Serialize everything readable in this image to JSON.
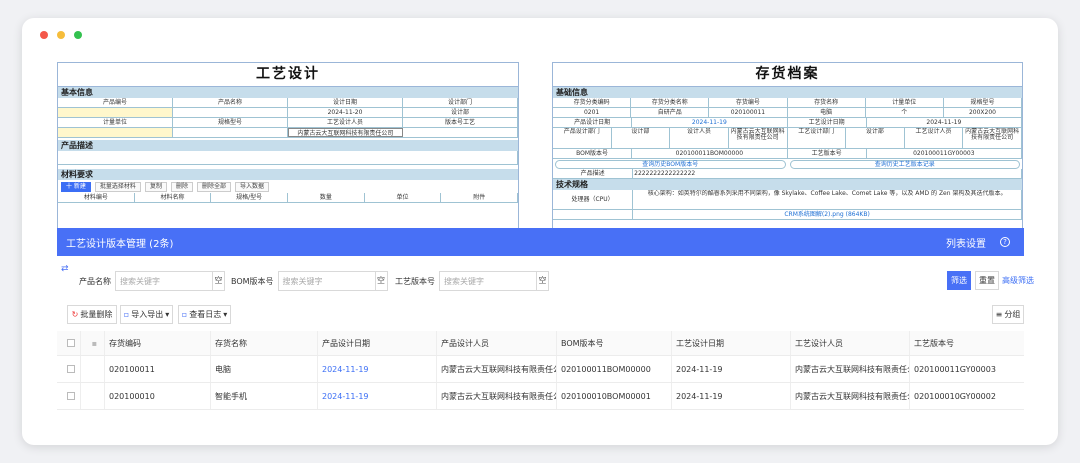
{
  "design_form": {
    "title": "工艺设计",
    "sections": {
      "basic": "基本信息",
      "desc": "产品描述",
      "materials": "材料要求"
    },
    "basic_headers": [
      "产品编号",
      "产品名称",
      "设计日期",
      "设计部门"
    ],
    "basic_row1": [
      "",
      "",
      "2024-11-20",
      "设计部"
    ],
    "basic_headers2": [
      "计量单位",
      "规格型号",
      "工艺设计人员",
      "版本号工艺"
    ],
    "basic_row2_person": "内蒙古云大互联网科技有限责任公司",
    "toolbar": [
      "十 新建",
      "批量选择材料",
      "复制",
      "删除",
      "删除全部",
      "导入数据"
    ],
    "material_headers": [
      "材料编号",
      "材料名称",
      "规格/型号",
      "数量",
      "单位",
      "附件"
    ]
  },
  "inventory_form": {
    "title": "存货档案",
    "sections": {
      "basic": "基础信息",
      "tech": "技术规格"
    },
    "headers": [
      "存货分类编码",
      "存货分类名称",
      "存货编号",
      "存货名称",
      "计量单位",
      "规格型号"
    ],
    "row1": [
      "0201",
      "自研产品",
      "020100011",
      "电脑",
      "个",
      "200X200"
    ],
    "row2": {
      "label1": "产品设计日期",
      "val1": "2024-11-19",
      "label2": "工艺设计日期",
      "val2": "2024-11-19"
    },
    "row3": {
      "l1": "产品设计部门",
      "v1": "设计部",
      "l2": "设计人员",
      "v2": "内蒙古云大互联网科技有限责任公司",
      "l3": "工艺设计部门",
      "v3": "设计部",
      "l4": "工艺设计人员",
      "v4": "内蒙古云大互联网科技有限责任公司"
    },
    "row4": {
      "l1": "BOM版本号",
      "v1": "020100011BOM00000",
      "l2": "工艺版本号",
      "v2": "020100011GY00003"
    },
    "links": [
      "查询历史BOM版本号",
      "查询历史工艺版本记录"
    ],
    "desc_label": "产品描述",
    "desc_value": "2222222222222222",
    "cpu_label": "处理器（CPU）",
    "cpu_value": "核心架构：如英特尔的酷睿系列采用不同架构，像 Skylake、Coffee Lake、Comet Lake 等，以及 AMD 的 Zen 架构及其迭代版本。",
    "attach": "CRM系统图解(2).png (864KB)"
  },
  "list": {
    "title": "工艺设计版本管理 (2条)",
    "header_right": "列表设置",
    "filters": [
      {
        "label": "产品名称",
        "placeholder": "搜索关键字"
      },
      {
        "label": "BOM版本号",
        "placeholder": "搜索关键字"
      },
      {
        "label": "工艺版本号",
        "placeholder": "搜索关键字"
      }
    ],
    "clear_label": "空",
    "filter_btn": "筛选",
    "reset_btn": "重置",
    "advanced": "高级筛选",
    "actions": [
      "批量删除",
      "导入导出",
      "查看日志"
    ],
    "group_btn": "分组",
    "columns": [
      "存货编码",
      "存货名称",
      "产品设计日期",
      "产品设计人员",
      "BOM版本号",
      "工艺设计日期",
      "工艺设计人员",
      "工艺版本号"
    ],
    "rows": [
      [
        "020100011",
        "电脑",
        "2024-11-19",
        "内蒙古云大互联网科技有限责任公司",
        "020100011BOM00000",
        "2024-11-19",
        "内蒙古云大互联网科技有限责任公司",
        "020100011GY00003"
      ],
      [
        "020100010",
        "智能手机",
        "2024-11-19",
        "内蒙古云大互联网科技有限责任公司",
        "020100010BOM00001",
        "2024-11-19",
        "内蒙古云大互联网科技有限责任公司",
        "020100010GY00002"
      ]
    ]
  },
  "colors": {
    "accent": "#4870f6",
    "section": "#c6ddeb",
    "dot_red": "#f4584a",
    "dot_yellow": "#f6bd3b",
    "dot_green": "#33c14f"
  }
}
